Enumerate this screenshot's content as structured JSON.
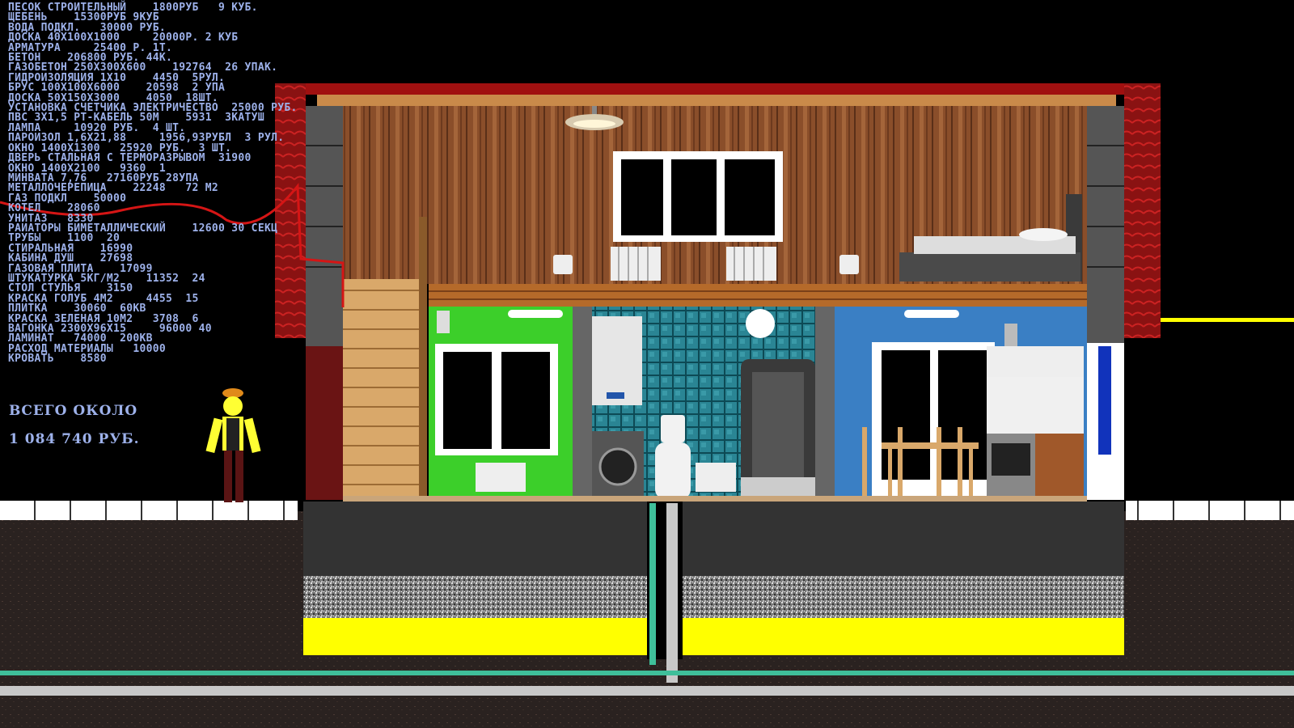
{
  "cost_list": [
    "песок строительный    1800руб   9 куб.",
    "щебень    15300руб 9куб",
    "вода подкл.   30000 руб.",
    "доска 40х100х1000     20000р. 2 куб",
    "арматура     25400 р. 1т.",
    "бетон    206800 руб. 44к.",
    "газобетон 250х300х600    192764  26 упак.",
    "гидроизоляция 1х10    4450  5рул.",
    "брус 100х100х6000    20598  2 упа",
    "доска 50х150х3000    4050  18шт.",
    "установка счетчика электричество  25000 руб.",
    "пвс 3х1,5 рт-кабель 50м    5931  3катуш",
    "лампа     10920 руб.  4 шт.",
    "пароизол 1,6х21,88     1956,93рубл  3 рул.",
    "окно 1400х1300   25920 руб.  3 шт.",
    "дверь стальная с терморазрывом  31900",
    "окно 1400х2100   9360  1",
    "минвата 7,76   27160руб 28упа",
    "металлочерепица    22248   72 м2",
    "газ подкл    50000",
    "котел    28060",
    "унитаз   8330",
    "раиаторы биметаллический    12600 30 секц",
    "трубы    1100  20",
    "стиральная    16990",
    "кабина душ    27698",
    "газовая плита    17099",
    "штукатурка 5кг/м2    11352  24",
    "стол стулья    3150",
    "краска голуб 4м2     4455  15",
    "плитка    30060  60кв",
    "краска зеленая 10м2   3708  6",
    "вагонка 2300х96х15     96000 40",
    "ламинат   74000  200кв",
    "расход материалы   10000",
    "кровать    8580"
  ],
  "total_label": "всего около",
  "total_value": "1 084 740 руб.",
  "colors": {
    "text": "#9db1ea",
    "roof": "#8a1212",
    "wood_wall": "#8a4e2a",
    "green_room": "#3ccf2a",
    "blue_room": "#3a7fc4",
    "tile": "#1f6b78",
    "sand": "#ffff00",
    "soil": "#2a2220",
    "gas_line": "#ffff00"
  },
  "icons": [
    "worker-figure",
    "ceiling-lamp-icon",
    "boiler-icon",
    "washing-machine-icon",
    "toilet-icon",
    "shower-cabin-icon",
    "bed-icon",
    "radiator-icon",
    "socket-icon",
    "window-icon",
    "staircase-icon",
    "kitchen-icon",
    "table-chairs-icon"
  ]
}
